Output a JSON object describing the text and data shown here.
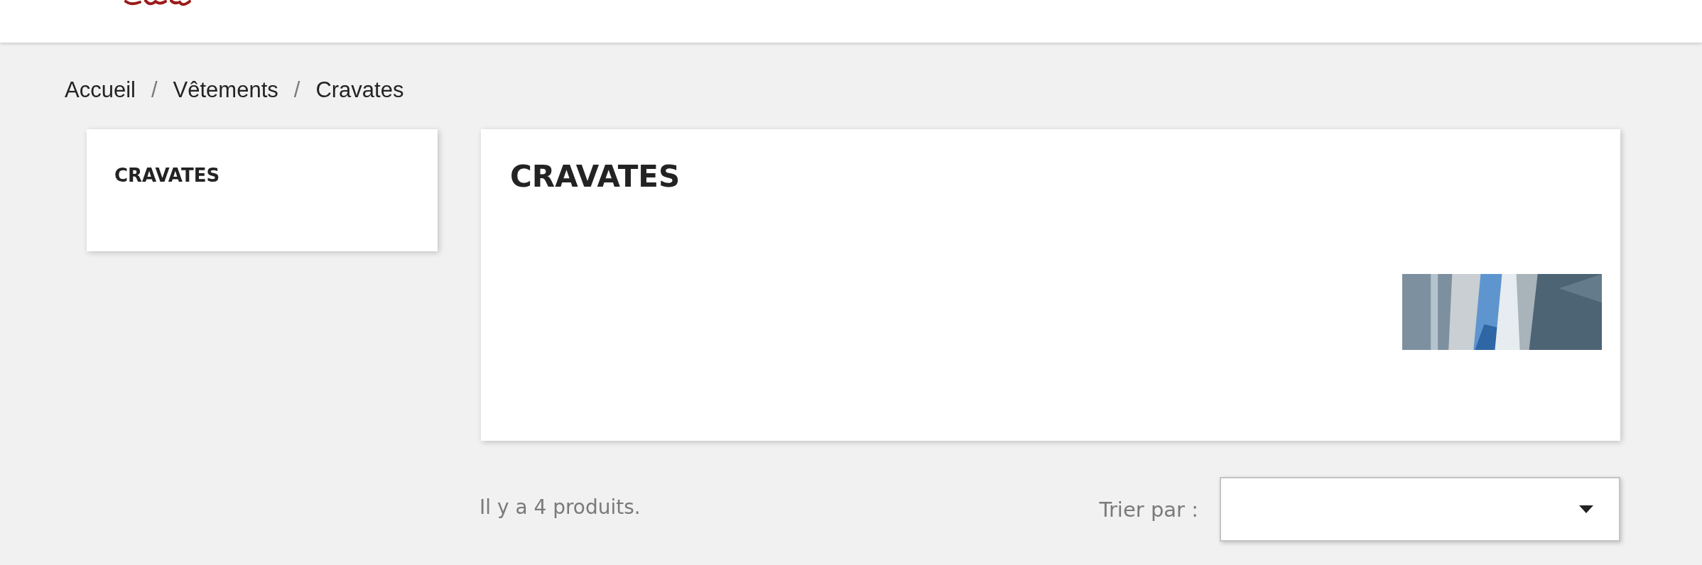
{
  "breadcrumb": [
    {
      "label": "Accueil"
    },
    {
      "label": "Vêtements"
    },
    {
      "label": "Cravates"
    }
  ],
  "breadcrumb_separator": "/",
  "sidebar": {
    "title": "CRAVATES"
  },
  "category": {
    "title": "CRAVATES"
  },
  "products": {
    "count_text": "Il y a 4 produits.",
    "sort_label": "Trier par :"
  }
}
